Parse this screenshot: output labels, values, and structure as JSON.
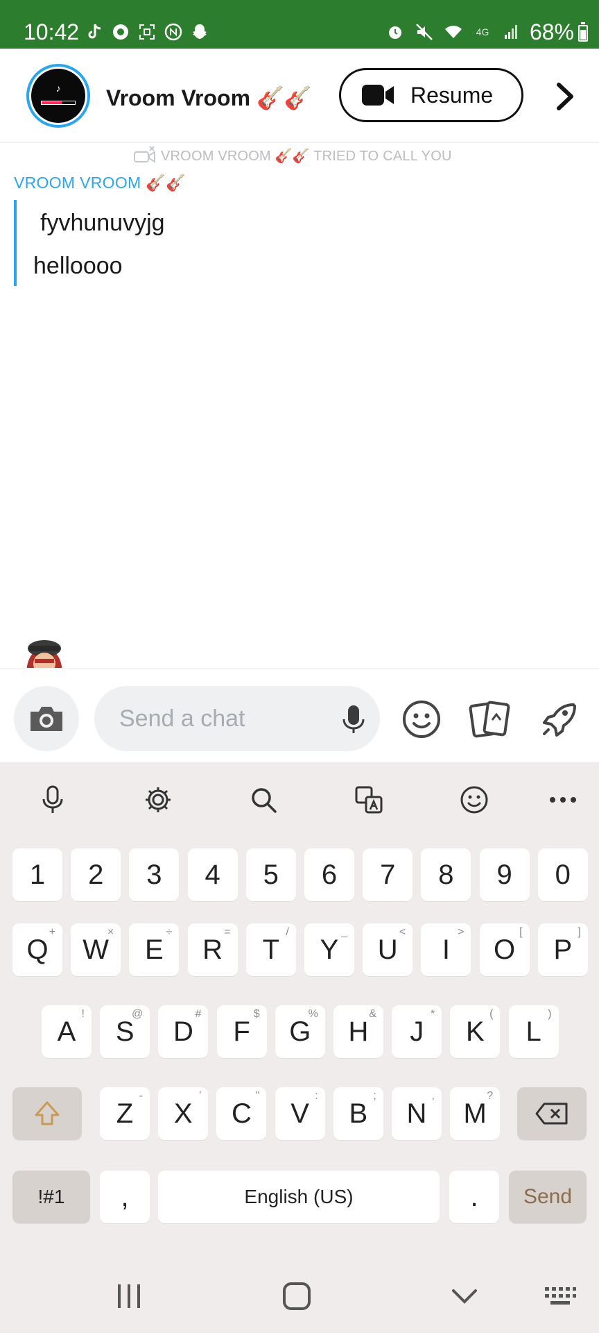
{
  "status_bar": {
    "time": "10:42",
    "battery_text": "68%",
    "icons_left": [
      "tiktok-icon",
      "social-icon",
      "screenshot-icon",
      "nfc-icon",
      "snapchat-icon"
    ],
    "icons_right": [
      "alarm-icon",
      "mute-icon",
      "wifi-icon",
      "lte-icon",
      "signal-icon",
      "battery-icon"
    ],
    "background_color": "#2d7d2f"
  },
  "header": {
    "title": "Vroom Vroom 🎸🎸",
    "avatar_logo": "♪",
    "resume_label": "Resume",
    "accent_color": "#2aa6ec"
  },
  "chat": {
    "call_notice": "VROOM VROOM 🎸🎸 TRIED TO CALL YOU",
    "sender_name": "VROOM VROOM 🎸🎸",
    "messages": [
      "fyvhunuvyjg",
      "helloooo"
    ]
  },
  "input": {
    "placeholder": "Send a chat"
  },
  "keyboard": {
    "number_row": [
      "1",
      "2",
      "3",
      "4",
      "5",
      "6",
      "7",
      "8",
      "9",
      "0"
    ],
    "row1": [
      {
        "k": "Q",
        "s": "+"
      },
      {
        "k": "W",
        "s": "×"
      },
      {
        "k": "E",
        "s": "÷"
      },
      {
        "k": "R",
        "s": "="
      },
      {
        "k": "T",
        "s": "/"
      },
      {
        "k": "Y",
        "s": "_"
      },
      {
        "k": "U",
        "s": "<"
      },
      {
        "k": "I",
        "s": ">"
      },
      {
        "k": "O",
        "s": "["
      },
      {
        "k": "P",
        "s": "]"
      }
    ],
    "row2": [
      {
        "k": "A",
        "s": "!"
      },
      {
        "k": "S",
        "s": "@"
      },
      {
        "k": "D",
        "s": "#"
      },
      {
        "k": "F",
        "s": "$"
      },
      {
        "k": "G",
        "s": "%"
      },
      {
        "k": "H",
        "s": "&"
      },
      {
        "k": "J",
        "s": "*"
      },
      {
        "k": "K",
        "s": "("
      },
      {
        "k": "L",
        "s": ")"
      }
    ],
    "row3": [
      {
        "k": "Z",
        "s": "-"
      },
      {
        "k": "X",
        "s": "'"
      },
      {
        "k": "C",
        "s": "\""
      },
      {
        "k": "V",
        "s": ":"
      },
      {
        "k": "B",
        "s": ";"
      },
      {
        "k": "N",
        "s": ","
      },
      {
        "k": "M",
        "s": "?"
      }
    ],
    "symbols_label": "!#1",
    "comma_label": ",",
    "space_label": "English (US)",
    "period_label": ".",
    "send_label": "Send"
  }
}
